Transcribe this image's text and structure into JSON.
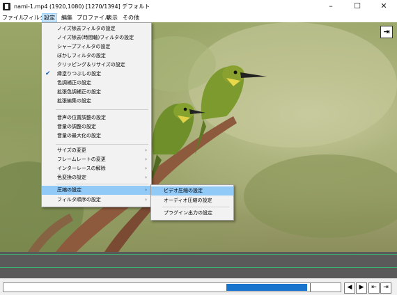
{
  "window": {
    "title": "nami-1.mp4 (1920,1080)  [1270/1394]  デフォルト",
    "minimize_icon": "minimize-icon",
    "maximize_icon": "maximize-icon",
    "close_icon": "close-icon"
  },
  "menubar": {
    "items": [
      "ファイル",
      "フィルタ",
      "設定",
      "編集",
      "プロファイル",
      "表示",
      "その他"
    ],
    "active": "設定"
  },
  "settings_menu": {
    "items": [
      {
        "label": "ノイズ除去フィルタの設定"
      },
      {
        "label": "ノイズ除去(時間軸)フィルタの設定"
      },
      {
        "label": "シャープフィルタの設定"
      },
      {
        "label": "ぼかしフィルタの設定"
      },
      {
        "label": "クリッピング＆リサイズの設定"
      },
      {
        "label": "縁塗りつぶしの設定",
        "checked": true
      },
      {
        "label": "色調補正の設定"
      },
      {
        "label": "拡張色調補正の設定"
      },
      {
        "label": "拡張編集の設定"
      },
      {
        "label": "音声の位置調整の設定"
      },
      {
        "label": "音量の調整の設定"
      },
      {
        "label": "音量の最大化の設定"
      },
      {
        "label": "サイズの変更",
        "submenu": true
      },
      {
        "label": "フレームレートの変更",
        "submenu": true
      },
      {
        "label": "インターレースの解除",
        "submenu": true
      },
      {
        "label": "色変換の設定",
        "submenu": true
      },
      {
        "label": "圧縮の設定",
        "submenu": true,
        "highlighted": true
      },
      {
        "label": "フィルタ順序の設定",
        "submenu": true
      }
    ]
  },
  "compression_submenu": {
    "items": [
      {
        "label": "ビデオ圧縮の設定",
        "highlighted": true
      },
      {
        "label": "オーディオ圧縮の設定"
      },
      {
        "label": "プラグイン出力の設定"
      }
    ]
  },
  "playback": {
    "progress": 0.9,
    "buttons": [
      "prev-frame-icon",
      "next-frame-icon",
      "skip-start-icon",
      "skip-end-icon"
    ]
  }
}
